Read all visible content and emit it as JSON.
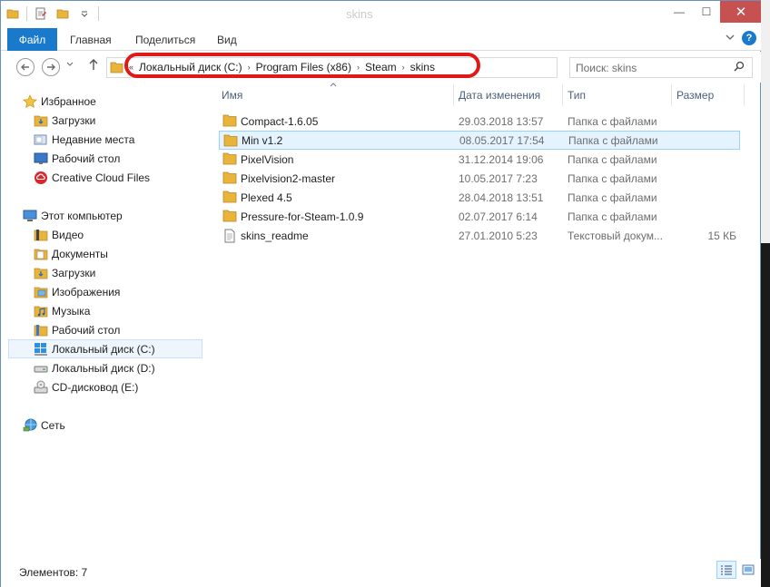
{
  "window": {
    "title": "skins",
    "minimize": "—",
    "maximize": "☐",
    "close": "✕"
  },
  "ribbon": {
    "tabs": [
      "Файл",
      "Главная",
      "Поделиться",
      "Вид"
    ],
    "expand_icon": "chevron-down-icon",
    "help_label": "?"
  },
  "address": {
    "crumbs": [
      "Локальный диск (C:)",
      "Program Files (x86)",
      "Steam",
      "skins"
    ],
    "overflow": "«",
    "separator": "›"
  },
  "search": {
    "placeholder": "Поиск: skins"
  },
  "nav_pane": {
    "favorites": {
      "label": "Избранное",
      "items": [
        "Загрузки",
        "Недавние места",
        "Рабочий стол",
        "Creative Cloud Files"
      ]
    },
    "computer": {
      "label": "Этот компьютер",
      "items": [
        "Видео",
        "Документы",
        "Загрузки",
        "Изображения",
        "Музыка",
        "Рабочий стол",
        "Локальный диск (C:)",
        "Локальный диск (D:)",
        "CD-дисковод (E:)"
      ],
      "selected": "Локальный диск (C:)"
    },
    "network": {
      "label": "Сеть"
    }
  },
  "columns": {
    "name": "Имя",
    "date": "Дата изменения",
    "type": "Тип",
    "size": "Размер"
  },
  "files": [
    {
      "name": "Compact-1.6.05",
      "date": "29.03.2018 13:57",
      "type": "Папка с файлами",
      "size": "",
      "kind": "folder"
    },
    {
      "name": "Min v1.2",
      "date": "08.05.2017 17:54",
      "type": "Папка с файлами",
      "size": "",
      "kind": "folder",
      "selected": true
    },
    {
      "name": "PixelVision",
      "date": "31.12.2014 19:06",
      "type": "Папка с файлами",
      "size": "",
      "kind": "folder"
    },
    {
      "name": "Pixelvision2-master",
      "date": "10.05.2017 7:23",
      "type": "Папка с файлами",
      "size": "",
      "kind": "folder"
    },
    {
      "name": "Plexed 4.5",
      "date": "28.04.2018 13:51",
      "type": "Папка с файлами",
      "size": "",
      "kind": "folder"
    },
    {
      "name": "Pressure-for-Steam-1.0.9",
      "date": "02.07.2017 6:14",
      "type": "Папка с файлами",
      "size": "",
      "kind": "folder"
    },
    {
      "name": "skins_readme",
      "date": "27.01.2010 5:23",
      "type": "Текстовый докум...",
      "size": "15 КБ",
      "kind": "text"
    }
  ],
  "status": {
    "items_count": "Элементов: 7"
  },
  "colors": {
    "accent": "#1979ca",
    "annotation": "#e01818",
    "folder": "#e8b43a",
    "selection_bg": "#e5f3ff",
    "selection_border": "#99d1ff"
  }
}
